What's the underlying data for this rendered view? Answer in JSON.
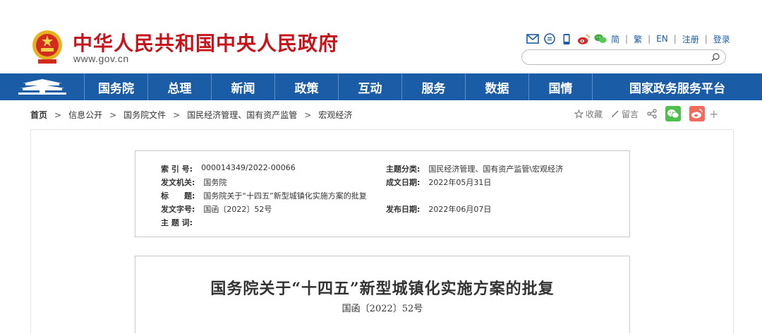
{
  "header": {
    "site_title": "中华人民共和国中央人民政府",
    "site_url": "www.gov.cn",
    "emblem_icon": "national-emblem-icon",
    "links": {
      "simplified": "简",
      "traditional": "繁",
      "english": "EN",
      "register": "注册",
      "login": "登录"
    },
    "search_placeholder": ""
  },
  "nav": {
    "items": [
      "国务院",
      "总理",
      "新闻",
      "政策",
      "互动",
      "服务",
      "数据",
      "国情",
      "国家政务服务平台"
    ]
  },
  "breadcrumb": [
    "首页",
    "信息公开",
    "国务院文件",
    "国民经济管理、国有资产监管",
    "宏观经济"
  ],
  "tools": {
    "favorite": "收藏",
    "comment": "留言",
    "plus": "+"
  },
  "meta": {
    "index_label": "索 引 号:",
    "index_value": "000014349/2022-00066",
    "category_label": "主题分类:",
    "category_value": "国民经济管理、国有资产监管\\宏观经济",
    "issuer_label": "发文机关:",
    "issuer_value": "国务院",
    "written_label": "成文日期:",
    "written_value": "2022年05月31日",
    "title_label": "标　　题:",
    "title_value": "国务院关于“十四五”新型城镇化实施方案的批复",
    "docno_label": "发文字号:",
    "docno_value": "国函〔2022〕52号",
    "publish_label": "发布日期:",
    "publish_value": "2022年06月07日",
    "keywords_label": "主 题 词:",
    "keywords_value": ""
  },
  "document": {
    "title": "国务院关于“十四五”新型城镇化实施方案的批复",
    "number": "国函〔2022〕52号"
  },
  "colors": {
    "brand_red": "#c5151c",
    "nav_blue": "#1a5ca6",
    "wechat_green": "#4cbf4c",
    "weibo_red": "#f06b5b"
  }
}
